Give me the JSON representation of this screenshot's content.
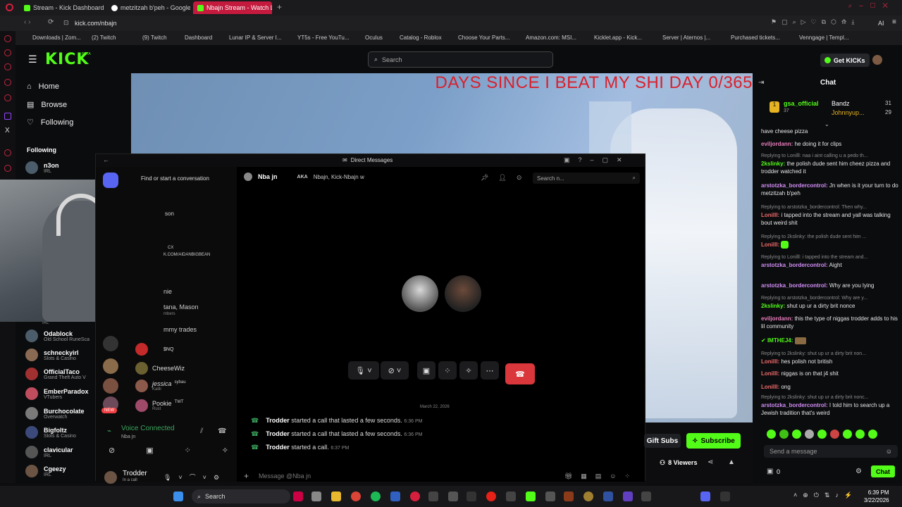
{
  "browser": {
    "tabs": [
      {
        "label": "Stream - Kick Dashboard"
      },
      {
        "label": "metzitzah b'peh - Google"
      },
      {
        "label": "Nbajn Stream - Watch Live"
      }
    ],
    "url": "kick.com/nbajn",
    "bookmarks": [
      "Downloads | Zom...",
      "(2) Twitch",
      "(9) Twitch",
      "Dashboard",
      "Lunar IP & Server I...",
      "YT5s - Free YouTu...",
      "Oculus",
      "Catalog - Roblox",
      "Choose Your Parts...",
      "Amazon.com: MSI...",
      "Kicklet.app - Kick...",
      "Server | Aternos |...",
      "Purchased tickets...",
      "Venngage | Templ..."
    ],
    "ai_label": "AI"
  },
  "kick": {
    "logo": "KICK",
    "logo_tag": "BETA",
    "search_placeholder": "Search",
    "get_kicks": "Get KICKs",
    "nav": [
      {
        "label": "Home",
        "icon": "home-icon"
      },
      {
        "label": "Browse",
        "icon": "browse-icon"
      },
      {
        "label": "Following",
        "icon": "heart-icon"
      }
    ],
    "following_heading": "Following",
    "following": [
      {
        "name": "n3on",
        "cat": "IRL"
      },
      {
        "name": "Odablock",
        "cat": "Old School RuneSca"
      },
      {
        "name": "schneckyirl",
        "cat": "Slots & Casino"
      },
      {
        "name": "OfficialTaco",
        "cat": "Grand Theft Auto V"
      },
      {
        "name": "EmberParadox",
        "cat": "VTubers"
      },
      {
        "name": "Burchocolate",
        "cat": "Overwatch"
      },
      {
        "name": "Bigfoltz",
        "cat": "Slots & Casino"
      },
      {
        "name": "clavicular",
        "cat": "IRL"
      },
      {
        "name": "Cgeezy",
        "cat": "IRL"
      }
    ],
    "irl_small": "IRL",
    "stream_title_overlay": "DAYS SINCE I BEAT MY SHI DAY 0/365",
    "gift_subs": "Gift Subs",
    "subscribe": "Subscribe",
    "viewers": "8 Viewers"
  },
  "discord": {
    "window_title": "Direct Messages",
    "find_placeholder": "Find or start a conversation",
    "dm_user": "Nba jn",
    "aka_label": "AKA",
    "aka_names": "Nbajn, Kick-Nbajn w",
    "search_placeholder": "Search n...",
    "partial": [
      "son",
      "CX",
      "K.COM/AIDANBIGBEAN",
      "nie",
      "tana, Mason",
      "mbers",
      "mmy trades"
    ],
    "dms": [
      {
        "name": "$NQ",
        "tag": ""
      },
      {
        "name": "CheeseWiz",
        "tag": ""
      },
      {
        "name": "jessica",
        "tag": "sybau",
        "sub": "Kalili"
      },
      {
        "name": "Pookie",
        "tag": "TWT",
        "sub": "Rust"
      }
    ],
    "new_badge": "NEW",
    "voice_connected": "Voice Connected",
    "voice_sub": "Nba jn",
    "user": "Trodder",
    "user_status": "In a call",
    "date_divider": "March 22, 2026",
    "messages": [
      {
        "user": "Trodder",
        "text": "started a call that lasted a few seconds.",
        "time": "6:36 PM"
      },
      {
        "user": "Trodder",
        "text": "started a call that lasted a few seconds.",
        "time": "6:36 PM"
      },
      {
        "user": "Trodder",
        "text": "started a call.",
        "time": "6:37 PM"
      }
    ],
    "message_placeholder": "Message @Nba jn"
  },
  "chat": {
    "title": "Chat",
    "top_gifter": "gsa_official",
    "top_gifter_count": "37",
    "leaders": [
      {
        "name": "Bandz",
        "count": "31"
      },
      {
        "name": "Johnnyup...",
        "count": "29"
      }
    ],
    "messages": [
      {
        "reply": "",
        "user": "",
        "text": "have cheese pizza",
        "color": "#ccc"
      },
      {
        "reply": "",
        "user": "eviljordann:",
        "text": "he doing it for clips",
        "color": "#e87cbb"
      },
      {
        "reply": "Replying to Lonilll: naa i aint calling u a pedo th...",
        "user": "2kslinky:",
        "text": "the polish dude sent him cheez pizza and trodder watched it",
        "color": "#53fc18"
      },
      {
        "reply": "",
        "user": "arstotzka_bordercontrol:",
        "text": "Jn when is it your turn to do metzitzah b'peh",
        "color": "#d18ef5"
      },
      {
        "reply": "Replying to arstotzka_bordercontrol: Then why...",
        "user": "Lonilll:",
        "text": "i tapped into the stream and yall was talking bout weird shit",
        "color": "#f06a6a"
      },
      {
        "reply": "Replying to 2kslinky: the polish dude sent him ...",
        "user": "Lonilll:",
        "text": "",
        "color": "#f06a6a"
      },
      {
        "reply": "Replying to Lonilll: i tapped into the stream and...",
        "user": "arstotzka_bordercontrol:",
        "text": "Aight",
        "color": "#d18ef5"
      },
      {
        "reply": "",
        "user": "arstotzka_bordercontrol:",
        "text": "Why are you lying",
        "color": "#d18ef5"
      },
      {
        "reply": "Replying to arstotzka_bordercontrol: Why are y...",
        "user": "2kslinky:",
        "text": "shut up ur a dirty brit nonce",
        "color": "#53fc18"
      },
      {
        "reply": "",
        "user": "eviljordann:",
        "text": "this the type of niggas trodder adds to his lil community",
        "color": "#e87cbb"
      },
      {
        "reply": "",
        "user": "IMTHEJ4:",
        "text": "",
        "color": "#53fc18"
      },
      {
        "reply": "Replying to 2kslinky: shut up ur a dirty brit non...",
        "user": "Lonilll:",
        "text": "hes polish not british",
        "color": "#f06a6a"
      },
      {
        "reply": "",
        "user": "Lonilll:",
        "text": "niggas is on that j4 shit",
        "color": "#f06a6a"
      },
      {
        "reply": "",
        "user": "Lonilll:",
        "text": "ong",
        "color": "#f06a6a"
      },
      {
        "reply": "Replying to 2kslinky: shut up ur a dirty brit nonc...",
        "user": "arstotzka_bordercontrol:",
        "text": "I told him to search up a Jewish tradition that's weird",
        "color": "#d18ef5"
      }
    ],
    "send_placeholder": "Send a message",
    "kicks_count": "0",
    "chat_button": "Chat"
  },
  "taskbar": {
    "search": "Search",
    "time": "6:39 PM",
    "date": "3/22/2026"
  }
}
